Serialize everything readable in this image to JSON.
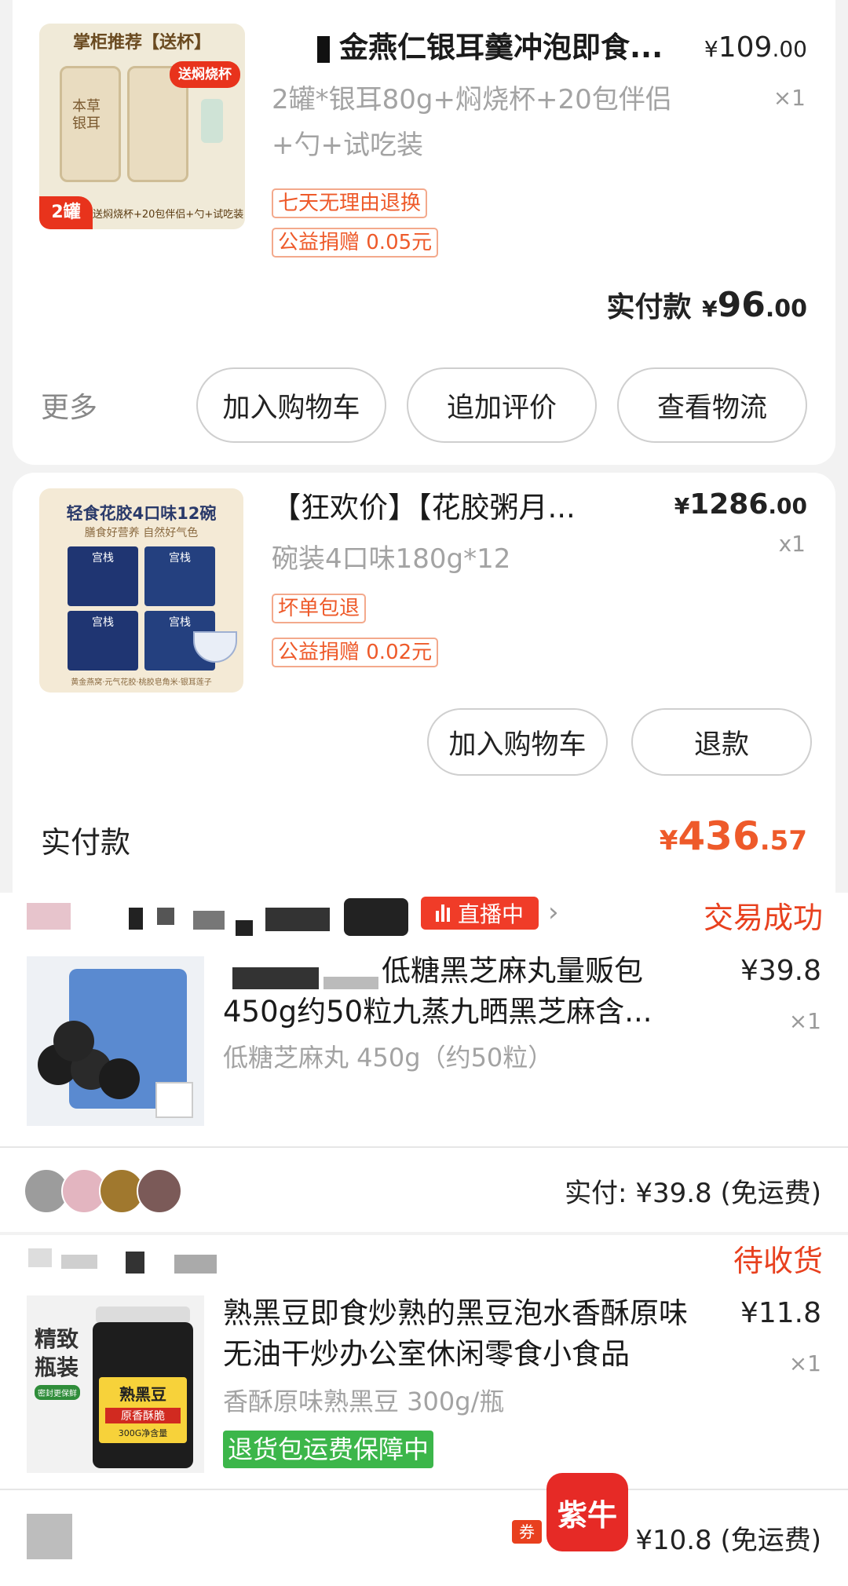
{
  "order1": {
    "item": {
      "thumb_top_label": "掌柜推荐【送杯】",
      "thumb_badge": "送焖烧杯",
      "thumb_jar_text": "本草银耳",
      "thumb_count": "2罐",
      "thumb_bottom_text": "送焖烧杯+20包伴侣+勺+试吃装",
      "title": "金燕仁银耳羹冲泡即食...",
      "price_currency": "¥",
      "price_int": "109",
      "price_dec": ".00",
      "spec": "2罐*银耳80g+焖烧杯+20包伴侣+勺+试吃装",
      "qty": "×1",
      "tags": [
        "七天无理由退换",
        "公益捐赠 0.05元"
      ]
    },
    "paid_label": "实付款",
    "paid_currency": "¥",
    "paid_int": "96",
    "paid_dec": ".00",
    "more_label": "更多",
    "buttons": [
      "加入购物车",
      "追加评价",
      "查看物流"
    ]
  },
  "order2": {
    "item": {
      "thumb_title": "轻食花胶4口味12碗",
      "thumb_subtitle": "膳食好营养 自然好气色",
      "thumb_box_label": "宫栈",
      "thumb_footer": "黄金燕窝·元气花胶·桃胶皂角米·银耳莲子",
      "title": "【狂欢价】【花胶粥月...",
      "price_currency": "¥",
      "price_int": "1286",
      "price_dec": ".00",
      "spec": "碗装4口味180g*12",
      "qty": "x1",
      "tags": [
        "坏单包退",
        "公益捐赠 0.02元"
      ]
    },
    "buttons": [
      "加入购物车",
      "退款"
    ],
    "paid_label": "实付款",
    "paid_currency": "¥",
    "paid_int": "436",
    "paid_dec": ".57"
  },
  "order3": {
    "live_label": "直播中",
    "status": "交易成功",
    "item": {
      "title_line1": "低糖黑芝麻丸量贩包",
      "title_line2": "450g约50粒九蒸九晒黑芝麻含...",
      "price": "¥39.8",
      "qty": "×1",
      "spec": "低糖芝麻丸 450g（约50粒）"
    },
    "paid_text": "实付: ¥39.8 (免运费)"
  },
  "order4": {
    "status": "待收货",
    "item": {
      "thumb_label": "精致瓶装",
      "thumb_sub": "密封更保鲜",
      "thumb_jar_title": "熟黑豆",
      "thumb_jar_sub": "原香酥脆",
      "thumb_jar_weight": "300G净含量",
      "title_line1": "熟黑豆即食炒熟的黑豆泡水香酥原味",
      "title_line2": "无油干炒办公室休闲零食小食品",
      "price": "¥11.8",
      "qty": "×1",
      "spec": "香酥原味熟黑豆 300g/瓶",
      "tag": "退货包运费保障中"
    },
    "coupon_label": "券",
    "paid_text": "¥10.8 (免运费)"
  },
  "watermark": "紫牛",
  "colors": {
    "accent_orange": "#ee5a2a",
    "status_red": "#e8401e",
    "live_red": "#f03c28",
    "green_tag": "#3cb64a"
  }
}
